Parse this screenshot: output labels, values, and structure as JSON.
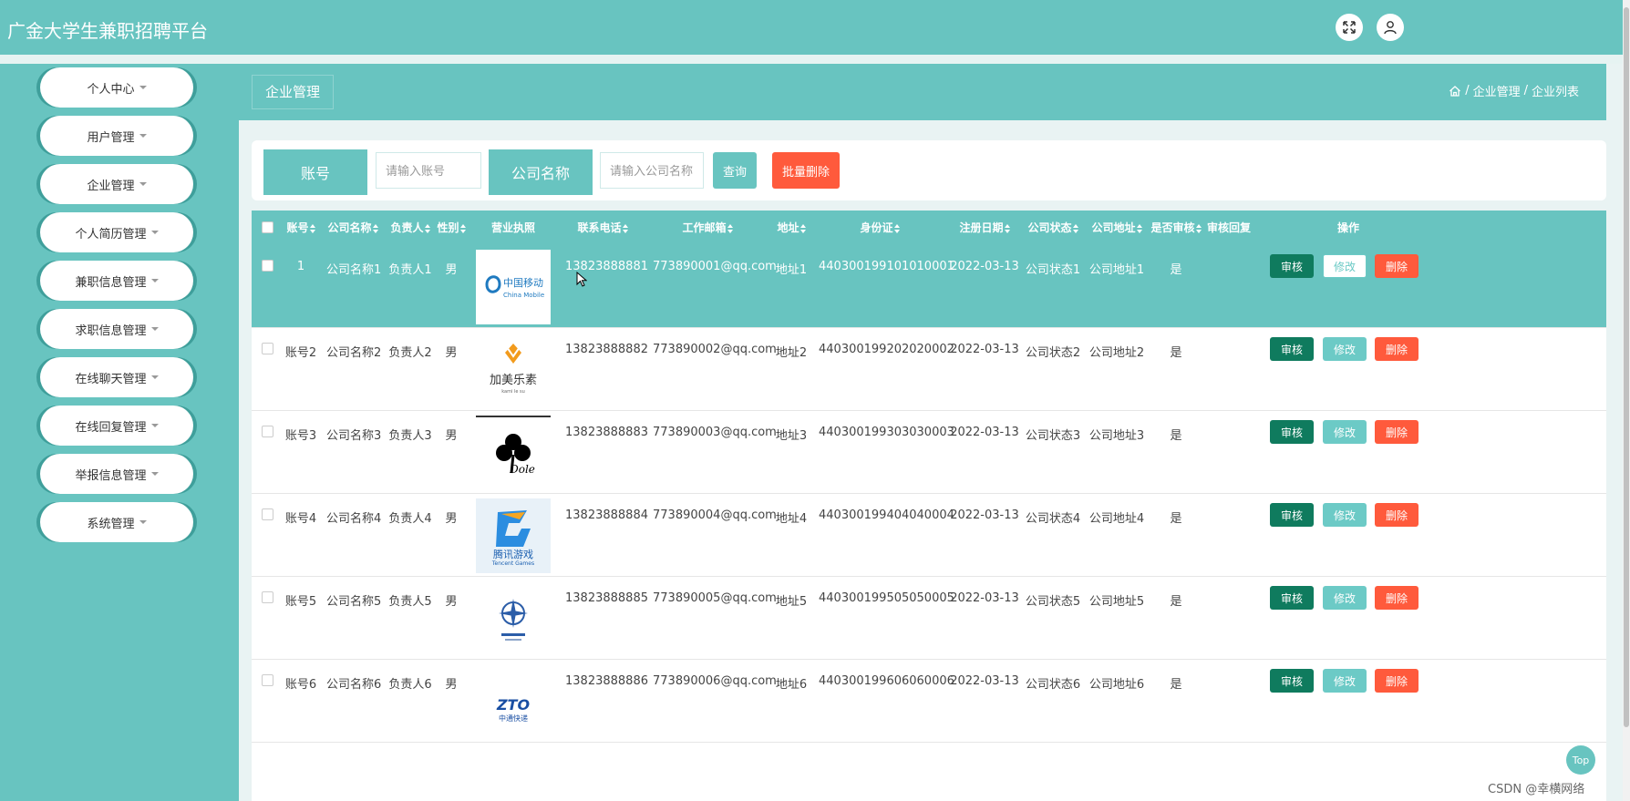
{
  "header": {
    "title": "广金大学生兼职招聘平台",
    "fullscreen_icon": "expand-icon",
    "user_icon": "user-icon"
  },
  "sidebar": {
    "items": [
      {
        "label": "个人中心"
      },
      {
        "label": "用户管理"
      },
      {
        "label": "企业管理"
      },
      {
        "label": "个人简历管理"
      },
      {
        "label": "兼职信息管理"
      },
      {
        "label": "求职信息管理"
      },
      {
        "label": "在线聊天管理"
      },
      {
        "label": "在线回复管理"
      },
      {
        "label": "举报信息管理"
      },
      {
        "label": "系统管理"
      }
    ]
  },
  "breadcrumb": {
    "title": "企业管理",
    "home_icon": "home-icon",
    "path1": "企业管理",
    "path2": "企业列表",
    "sep": "/"
  },
  "search": {
    "account_label": "账号",
    "account_placeholder": "请输入账号",
    "company_label": "公司名称",
    "company_placeholder": "请输入公司名称",
    "query_button": "查询",
    "batch_delete_button": "批量删除"
  },
  "table": {
    "headers": [
      "账号",
      "公司名称",
      "负责人",
      "性别",
      "营业执照",
      "联系电话",
      "工作邮箱",
      "地址",
      "身份证",
      "注册日期",
      "公司状态",
      "公司地址",
      "是否审核",
      "审核回复",
      "操作"
    ],
    "actions": {
      "audit": "审核",
      "edit": "修改",
      "delete": "删除"
    },
    "rows": [
      {
        "account": "1",
        "company": "公司名称1",
        "owner": "负责人1",
        "gender": "男",
        "logo": "china-mobile-logo",
        "phone": "13823888881",
        "email": "773890001@qq.com",
        "addr": "地址1",
        "idcard": "440300199101010001",
        "date": "2022-03-13",
        "status": "公司状态1",
        "caddr": "公司地址1",
        "audited": "是",
        "reply": ""
      },
      {
        "account": "账号2",
        "company": "公司名称2",
        "owner": "负责人2",
        "gender": "男",
        "logo": "kamei-logo",
        "phone": "13823888882",
        "email": "773890002@qq.com",
        "addr": "地址2",
        "idcard": "440300199202020002",
        "date": "2022-03-13",
        "status": "公司状态2",
        "caddr": "公司地址2",
        "audited": "是",
        "reply": ""
      },
      {
        "account": "账号3",
        "company": "公司名称3",
        "owner": "负责人3",
        "gender": "男",
        "logo": "clover-logo",
        "phone": "13823888883",
        "email": "773890003@qq.com",
        "addr": "地址3",
        "idcard": "440300199303030003",
        "date": "2022-03-13",
        "status": "公司状态3",
        "caddr": "公司地址3",
        "audited": "是",
        "reply": ""
      },
      {
        "account": "账号4",
        "company": "公司名称4",
        "owner": "负责人4",
        "gender": "男",
        "logo": "tencent-games-logo",
        "phone": "13823888884",
        "email": "773890004@qq.com",
        "addr": "地址4",
        "idcard": "440300199404040004",
        "date": "2022-03-13",
        "status": "公司状态4",
        "caddr": "公司地址4",
        "audited": "是",
        "reply": ""
      },
      {
        "account": "账号5",
        "company": "公司名称5",
        "owner": "负责人5",
        "gender": "男",
        "logo": "compass-logo",
        "phone": "13823888885",
        "email": "773890005@qq.com",
        "addr": "地址5",
        "idcard": "440300199505050005",
        "date": "2022-03-13",
        "status": "公司状态5",
        "caddr": "公司地址5",
        "audited": "是",
        "reply": ""
      },
      {
        "account": "账号6",
        "company": "公司名称6",
        "owner": "负责人6",
        "gender": "男",
        "logo": "zto-logo",
        "phone": "13823888886",
        "email": "773890006@qq.com",
        "addr": "地址6",
        "idcard": "440300199606060006",
        "date": "2022-03-13",
        "status": "公司状态6",
        "caddr": "公司地址6",
        "audited": "是",
        "reply": ""
      }
    ]
  },
  "logos": {
    "china_mobile": "中国移动",
    "china_mobile_en": "China Mobile",
    "kamei": "加美乐素",
    "kamei_en": "kami le su",
    "clover": "Dole",
    "tencent": "腾讯游戏",
    "tencent_en": "Tencent Games",
    "zto": "ZTO",
    "zto_cn": "中通快递"
  },
  "back_to_top": "Top",
  "watermark": "CSDN @幸横网络",
  "colors": {
    "primary": "#68c4c0",
    "audit": "#0f7b5e",
    "edit": "#6ccac6",
    "delete": "#ff5a3c"
  }
}
